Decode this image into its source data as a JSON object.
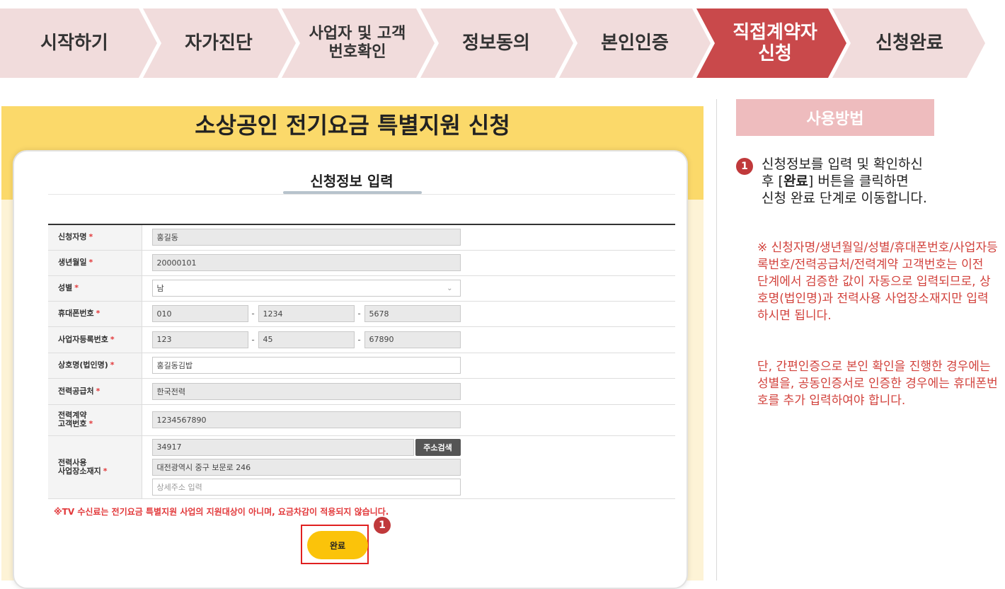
{
  "steps": [
    {
      "label": "시작하기"
    },
    {
      "label": "자가진단"
    },
    {
      "label": "사업자 및 고객번호확인"
    },
    {
      "label": "정보동의"
    },
    {
      "label": "본인인증"
    },
    {
      "label": "직접계약자 신청",
      "active": true
    },
    {
      "label": "신청완료"
    }
  ],
  "colors": {
    "step_bg": "#f1dcdc",
    "step_active": "#c9494b",
    "main_band_top": "#fbd96a",
    "main_band": "#fdf3d6",
    "accent_red": "#e2393b",
    "button_yellow": "#fbc30a"
  },
  "main": {
    "title": "소상공인 전기요금 특별지원 신청",
    "card_title": "신청정보 입력",
    "form": {
      "applicant_name": {
        "label": "신청자명",
        "value": "홍길동"
      },
      "birthdate": {
        "label": "생년월일",
        "value": "20000101"
      },
      "gender": {
        "label": "성별",
        "value": "남"
      },
      "phone": {
        "label": "휴대폰번호",
        "parts": [
          "010",
          "1234",
          "5678"
        ]
      },
      "business_no": {
        "label": "사업자등록번호",
        "parts": [
          "123",
          "45",
          "67890"
        ]
      },
      "company_name": {
        "label": "상호명(법인명)",
        "value": "홍길동김밥"
      },
      "power_supplier": {
        "label": "전력공급처",
        "value": "한국전력"
      },
      "contract_no": {
        "label_line1": "전력계약",
        "label_line2": "고객번호",
        "value": "1234567890"
      },
      "address": {
        "label_line1": "전력사용",
        "label_line2": "사업장소재지",
        "zip": "34917",
        "search_button": "주소검색",
        "road": "대전광역시 중구 보문로 246",
        "detail_placeholder": "상세주소 입력"
      },
      "required_mark": "*"
    },
    "notice": "※TV 수신료는 전기요금 특별지원 사업의 지원대상이 아니며, 요금차감이 적용되지 않습니다.",
    "done_button": "완료",
    "badge": "1"
  },
  "usage": {
    "header": "사용방법",
    "badge": "1",
    "step_line1": "신청정보를 입력 및 확인하신",
    "step_line2_pre": "후 [",
    "step_line2_bold": "완료",
    "step_line2_post": "] 버튼을 클릭하면",
    "step_line3": "신청 완료 단계로 이동합니다.",
    "note1": "※ 신청자명/생년월일/성별/휴대폰번호/사업자등록번호/전력공급처/전력계약 고객번호는 이전 단계에서 검증한 값이 자동으로 입력되므로, 상호명(법인명)과 전력사용 사업장소재지만 입력하시면 됩니다.",
    "note2": "단, 간편인증으로 본인 확인을 진행한 경우에는 성별을, 공동인증서로 인증한 경우에는 휴대폰번호를 추가 입력하여야 합니다."
  }
}
